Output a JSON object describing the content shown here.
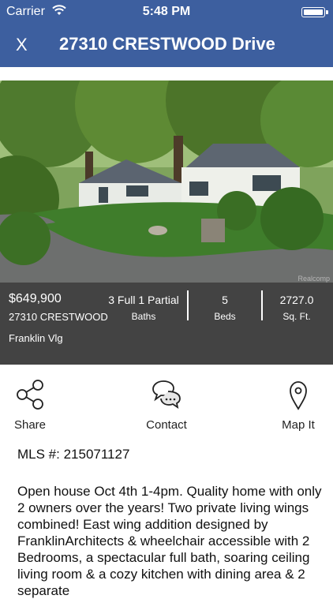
{
  "status_bar": {
    "carrier": "Carrier",
    "time": "5:48 PM"
  },
  "nav": {
    "close_label": "X",
    "title": "27310 CRESTWOOD Drive"
  },
  "photo": {
    "credit": "Realcomp"
  },
  "listing": {
    "price": "$649,900",
    "address": "27310 CRESTWOOD",
    "city": "Franklin Vlg",
    "baths_value": "3 Full 1 Partial",
    "baths_label": "Baths",
    "beds_value": "5",
    "beds_label": "Beds",
    "sqft_value": "2727.0",
    "sqft_label": "Sq. Ft."
  },
  "actions": {
    "share": "Share",
    "contact": "Contact",
    "map": "Map It"
  },
  "details": {
    "mls": "MLS #: 215071127",
    "description": "Open house Oct 4th 1-4pm. Quality home with only 2 owners over the years! Two private living wings combined! East wing addition designed by FranklinArchitects & wheelchair accessible with 2 Bedrooms, a spectacular full bath, soaring ceiling living room & a cozy kitchen with dining area & 2 separate"
  },
  "colors": {
    "header": "#3d5f9f",
    "info_band": "#434343"
  }
}
